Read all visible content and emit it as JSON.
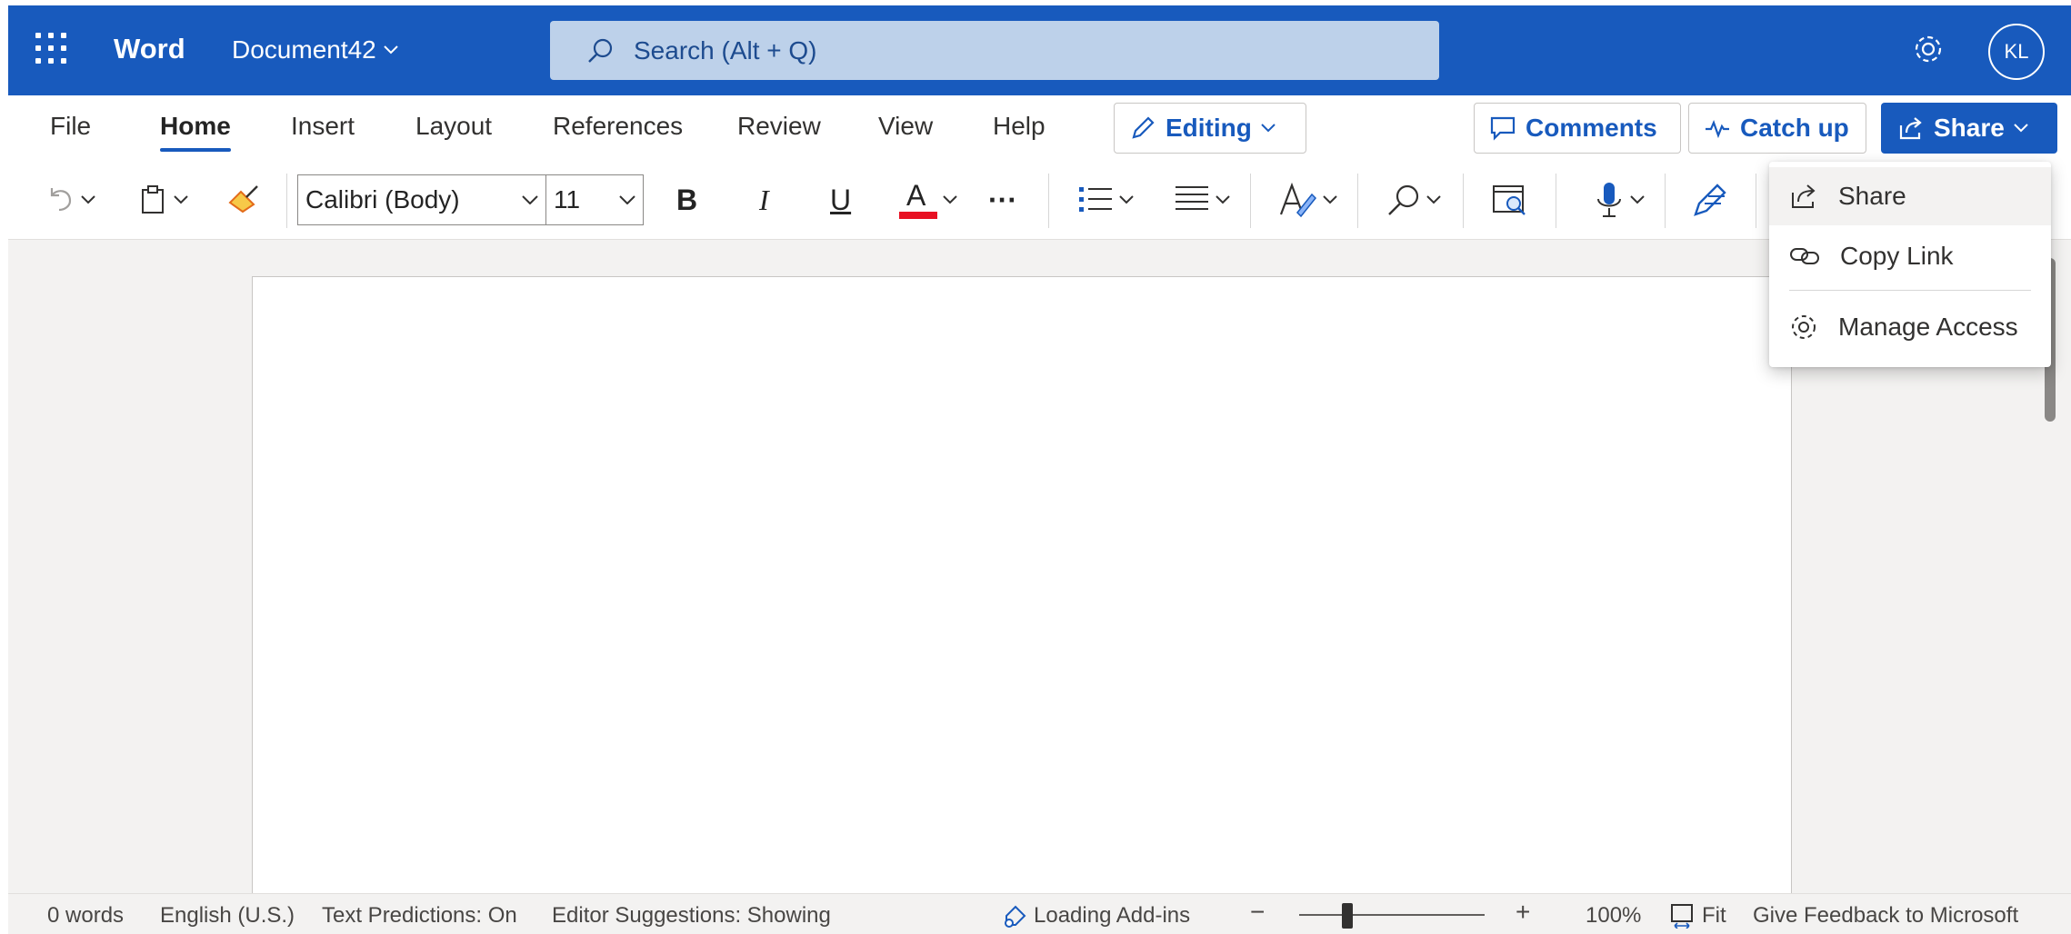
{
  "titlebar": {
    "app_name": "Word",
    "doc_title": "Document42",
    "search_placeholder": "Search (Alt + Q)",
    "avatar_initials": "KL",
    "color": "#185abd"
  },
  "menu": {
    "items": [
      "File",
      "Home",
      "Insert",
      "Layout",
      "References",
      "Review",
      "View",
      "Help"
    ],
    "active": "Home",
    "editing_label": "Editing",
    "comments_label": "Comments",
    "catchup_label": "Catch up",
    "share_label": "Share"
  },
  "toolbar": {
    "font_name": "Calibri (Body)",
    "font_size": "11",
    "bold": "B",
    "italic": "I",
    "underline": "U",
    "font_color_letter": "A",
    "more": "···",
    "font_color": "#e81123"
  },
  "share_menu": {
    "items": [
      "Share",
      "Copy Link",
      "Manage Access"
    ]
  },
  "statusbar": {
    "words": "0 words",
    "language": "English (U.S.)",
    "text_predictions": "Text Predictions: On",
    "editor_suggestions": "Editor Suggestions: Showing",
    "loading_addins": "Loading Add-ins",
    "zoom_minus": "−",
    "zoom_plus": "+",
    "zoom_level": "100%",
    "fit": "Fit",
    "feedback": "Give Feedback to Microsoft"
  }
}
